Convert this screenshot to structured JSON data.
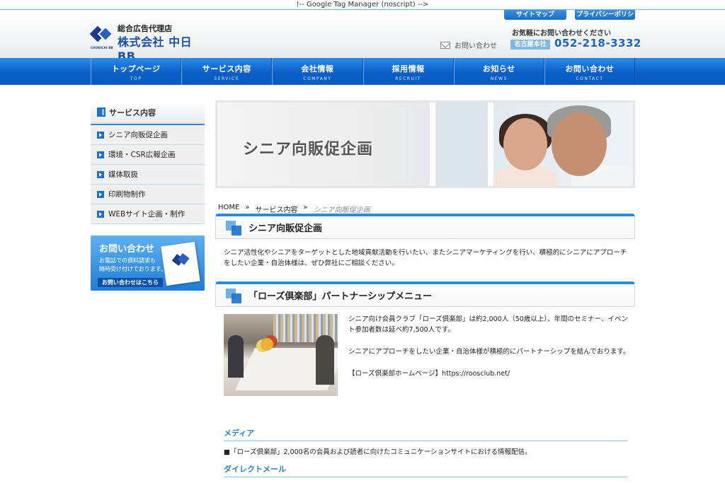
{
  "gtm_comment": "!-- Google Tag Manager (noscript) -->",
  "header": {
    "logo_tag": "総合広告代理店",
    "logo_name": "株式会社 中日BB",
    "logo_sub": "CHUNICHI BB",
    "util_links": [
      "サイトマップ",
      "プライバシーポリシー"
    ],
    "contact_hint": "お気軽にお問い合わせください",
    "contact_link": "お問い合わせ",
    "office": "名古屋本社",
    "phone": "052-218-3332"
  },
  "nav": [
    {
      "jp": "トップページ",
      "en": "TOP"
    },
    {
      "jp": "サービス内容",
      "en": "SERVICE"
    },
    {
      "jp": "会社情報",
      "en": "COMPANY"
    },
    {
      "jp": "採用情報",
      "en": "RECRUIT"
    },
    {
      "jp": "お知らせ",
      "en": "NEWS"
    },
    {
      "jp": "お問い合わせ",
      "en": "CONTACT"
    }
  ],
  "sidebar": {
    "heading": "サービス内容",
    "items": [
      "シニア向販促企画",
      "環境・CSR広報企画",
      "媒体取扱",
      "印刷物制作",
      "WEBサイト企画・制作"
    ],
    "banner": {
      "title": "お問い合わせ",
      "line1": "お電話での資料請求も",
      "line2": "随時受け付けております。",
      "button": "お問い合わせはこちら"
    }
  },
  "hero": {
    "title": "シニア向販促企画"
  },
  "breadcrumb": [
    "HOME",
    "»",
    "サービス内容",
    "»",
    "シニア向販促企画"
  ],
  "section1": {
    "title": "シニア向販促企画",
    "body": "シニア活性化やシニアをターゲットとした地域貢献活動を行いたい、またシニアマーケティングを行い、積極的にシニアにアプローチをしたい企業・自治体様は、ぜひ弊社にご相談ください。"
  },
  "section2": {
    "title": "「ローズ倶楽部」パートナーシップメニュー",
    "p1": "シニア向け会員クラブ「ローズ倶楽部」は約2,000人（50歳以上）、年間のセミナー、イベント参加者数は延べ約7,500人です。",
    "p2": "シニアにアプローチをしたい企業・自治体様が積極的にパートナーシップを結んでおります。",
    "p3": "【ローズ倶楽部ホームページ】https://roosclub.net/"
  },
  "media": {
    "heading": "メディア",
    "line": "■「ローズ倶楽部」2,000名の会員および読者に向けたコミュニケーションサイトにおける情報配信。"
  },
  "dm": {
    "heading": "ダイレクトメール"
  }
}
